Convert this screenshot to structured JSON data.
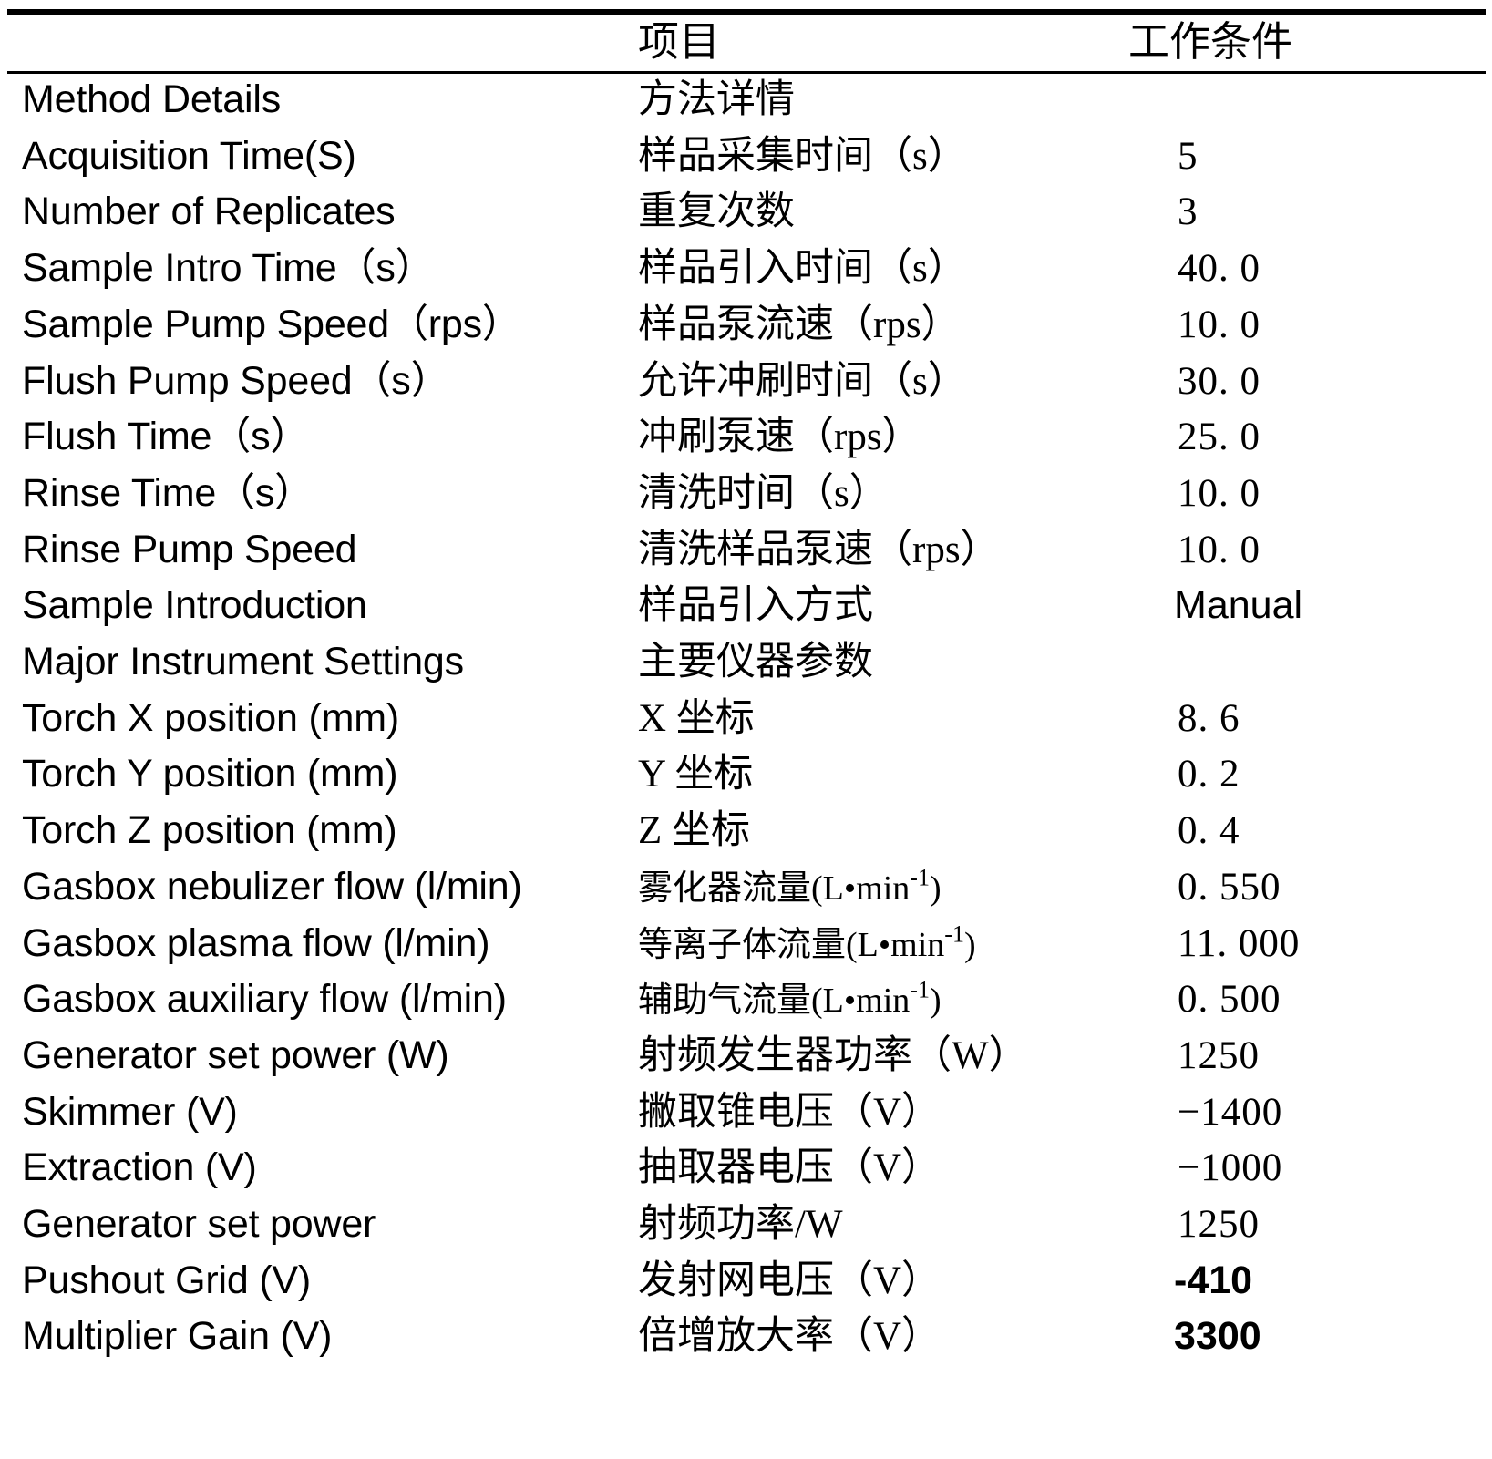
{
  "table": {
    "header": {
      "col_english": "",
      "col_chinese": "项目",
      "col_value": "工作条件"
    },
    "rows": [
      {
        "en": "Method   Details",
        "zh": "方法详情",
        "value": ""
      },
      {
        "en": "Acquisition Time(S)",
        "zh": "样品采集时间（s）",
        "value": "5"
      },
      {
        "en": "Number of Replicates",
        "zh": "重复次数",
        "value": "3"
      },
      {
        "en": "Sample Intro Time（s）",
        "zh": "样品引入时间（s）",
        "value": "40. 0"
      },
      {
        "en": "Sample Pump Speed（rps）",
        "zh": "样品泵流速（rps）",
        "value": "10. 0"
      },
      {
        "en": "Flush Pump Speed（s）",
        "zh": "允许冲刷时间（s）",
        "value": "30. 0"
      },
      {
        "en": "Flush Time（s）",
        "zh": "冲刷泵速（rps）",
        "value": "25. 0"
      },
      {
        "en": "Rinse Time（s）",
        "zh": "清洗时间（s）",
        "value": "10. 0"
      },
      {
        "en": "Rinse Pump Speed",
        "zh": "清洗样品泵速（rps）",
        "value": "10. 0"
      },
      {
        "en": "Sample Introduction",
        "zh": "样品引入方式",
        "value": "Manual",
        "value_style": "sans"
      },
      {
        "en": "Major Instrument Settings",
        "zh": "主要仪器参数",
        "value": ""
      },
      {
        "en": "Torch X position (mm)",
        "zh": "X 坐标",
        "value": "8. 6"
      },
      {
        "en": "Torch Y position (mm)",
        "zh": "Y 坐标",
        "value": "0. 2"
      },
      {
        "en": "Torch Z position (mm)",
        "zh": "Z 坐标",
        "value": "0. 4"
      },
      {
        "en": "Gasbox nebulizer flow (l/min)",
        "zh": "雾化器流量(L•min⁻¹)",
        "zh_base": "雾化器流量(L•min",
        "zh_sup": "-1",
        "zh_tail": ")",
        "value": "0. 550"
      },
      {
        "en": "Gasbox plasma flow (l/min)",
        "zh": "等离子体流量(L•min⁻¹)",
        "zh_base": "等离子体流量(L•min",
        "zh_sup": "-1",
        "zh_tail": ")",
        "value": "11. 000"
      },
      {
        "en": "Gasbox auxiliary flow (l/min)",
        "zh": "辅助气流量(L•min⁻¹)",
        "zh_base": "辅助气流量(L•min",
        "zh_sup": "-1",
        "zh_tail": ")",
        "value": "0. 500"
      },
      {
        "en": "Generator set power (W)",
        "zh": "射频发生器功率（W）",
        "value": "1250"
      },
      {
        "en": "Skimmer (V)",
        "zh": "撇取锥电压（V）",
        "value": "−1400"
      },
      {
        "en": "Extraction (V)",
        "zh": "抽取器电压（V）",
        "value": "−1000"
      },
      {
        "en": "Generator set power",
        "zh": "射频功率/W",
        "value": "1250"
      },
      {
        "en": "Pushout Grid (V)",
        "zh": "发射网电压（V）",
        "value": "-410",
        "value_style": "sans-bold"
      },
      {
        "en": "Multiplier Gain (V)",
        "zh": "倍增放大率（V）",
        "value": "3300",
        "value_style": "sans-bold"
      }
    ]
  }
}
